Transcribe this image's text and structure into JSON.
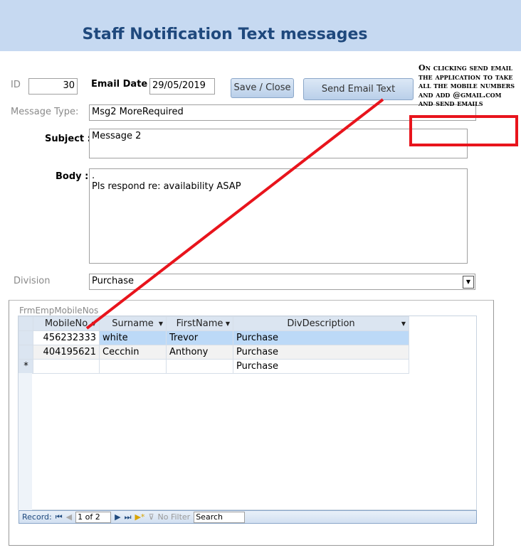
{
  "title": "Staff Notification Text messages",
  "form": {
    "id_label": "ID",
    "id_value": "30",
    "email_date_label": "Email Date",
    "email_date_value": "29/05/2019",
    "save_close": "Save / Close",
    "send_email_text": "Send Email Text",
    "message_type_label": "Message Type:",
    "message_type_value": "Msg2 MoreRequired",
    "subject_label": "Subject :",
    "subject_value": "Message 2",
    "body_label": "Body :",
    "body_line1": ".",
    "body_line2": "Pls respond re: availability  ASAP",
    "division_label": "Division",
    "division_value": "Purchase"
  },
  "annotation": {
    "text": "On clicking send email the application to take all the mobile numbers and add @gmail.com and send emails",
    "color": "#e8141c"
  },
  "subform": {
    "label": "FrmEmpMobileNos",
    "columns": [
      "MobileNo",
      "Surname",
      "FirstName",
      "DivDescription"
    ],
    "rows": [
      [
        "456232333",
        "white",
        "Trevor",
        "Purchase"
      ],
      [
        "404195621",
        "Cecchin",
        "Anthony",
        "Purchase"
      ]
    ],
    "new_row": {
      "marker": "*",
      "div": "Purchase"
    },
    "nav": {
      "record_label": "Record:",
      "position": "1 of 2",
      "no_filter": "No Filter",
      "search": "Search"
    }
  }
}
